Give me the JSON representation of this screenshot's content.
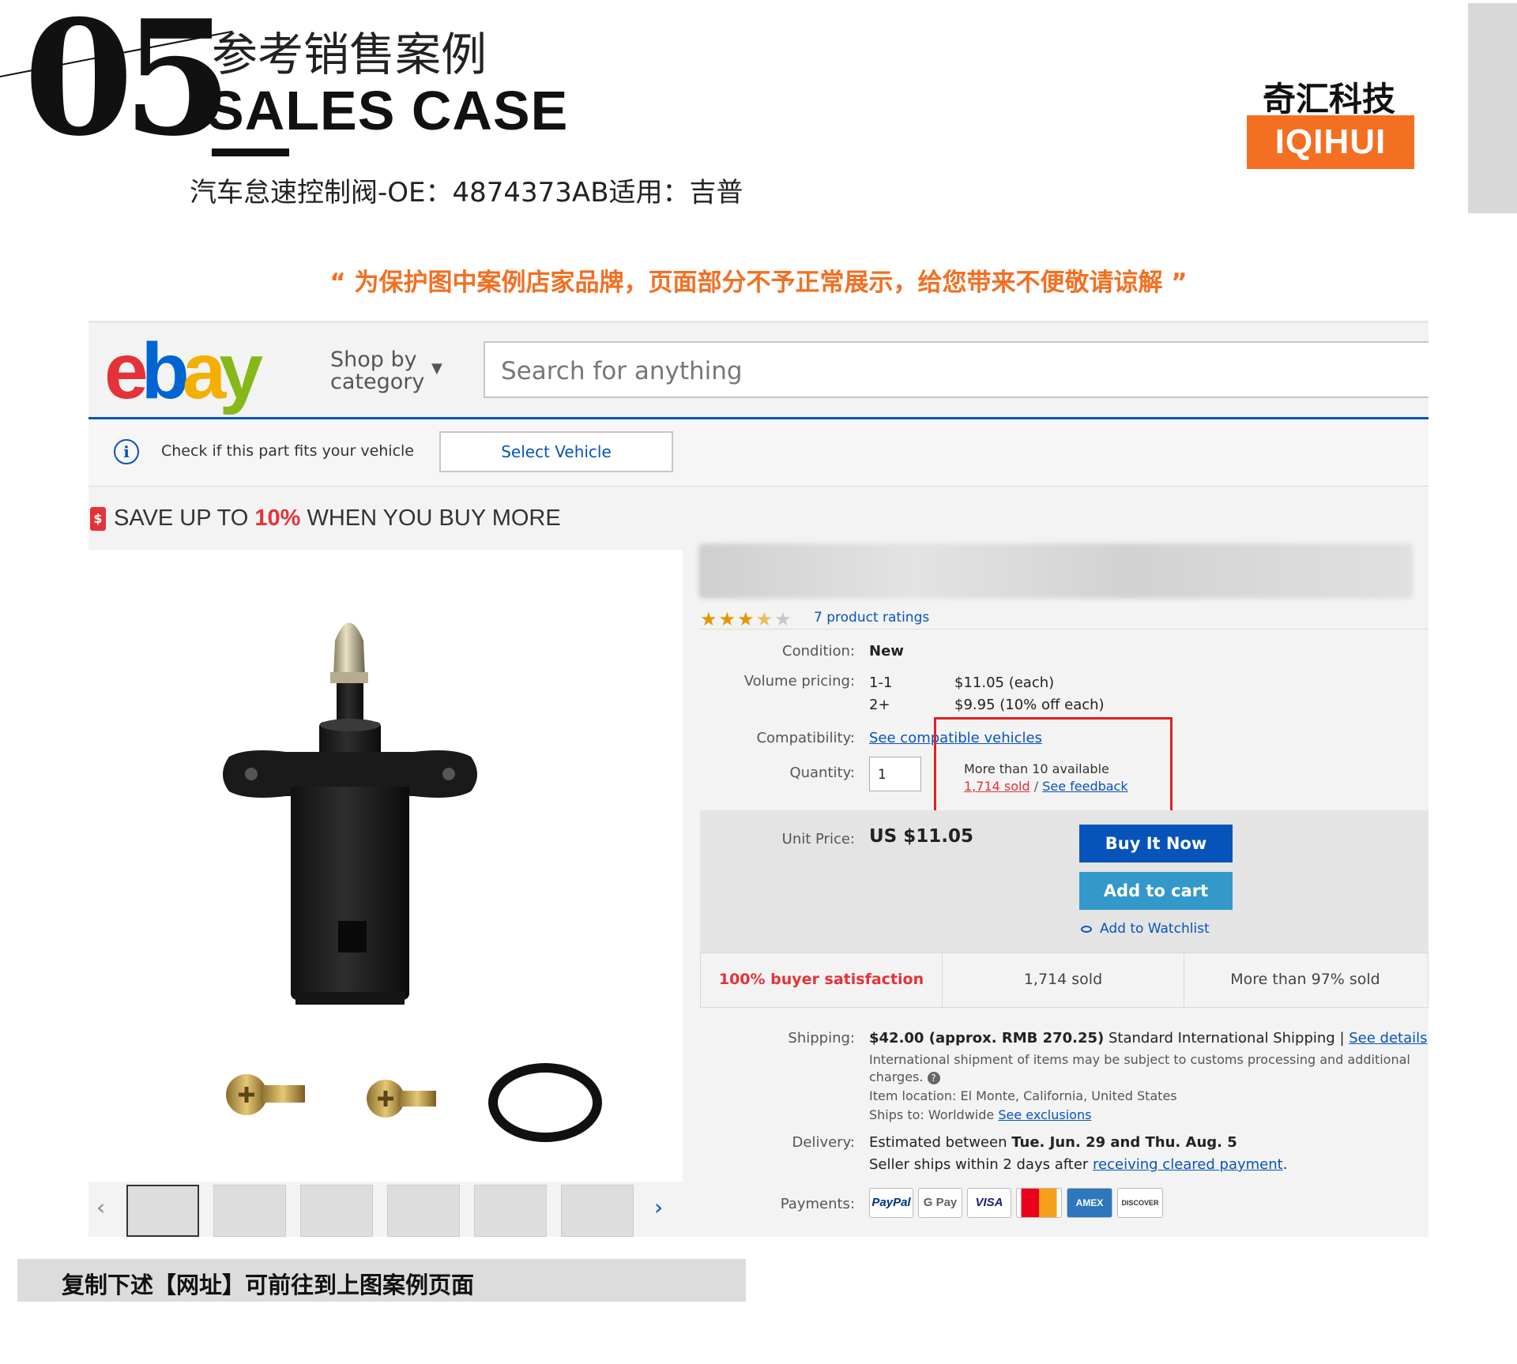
{
  "header": {
    "number": "05",
    "title_cn": "参考销售案例",
    "title_en": "SALES CASE",
    "subtitle": "汽车怠速控制阀-OE：4874373AB适用：吉普"
  },
  "brand": {
    "name_cn": "奇汇科技",
    "name_en": "IQIHUI",
    "accent": "#f36f22"
  },
  "notice": "“ 为保护图中案例店家品牌，页面部分不予正常展示，给您带来不便敬请谅解 ”",
  "ebay": {
    "logo": {
      "e": "e",
      "b": "b",
      "a": "a",
      "y": "y"
    },
    "shop_by_line1": "Shop by",
    "shop_by_line2": "category",
    "search_placeholder": "Search for anything",
    "fit_check_text": "Check if this part fits your vehicle",
    "select_vehicle": "Select Vehicle",
    "save_prefix": "SAVE UP TO ",
    "save_pct": "10%",
    "save_suffix": " WHEN YOU BUY MORE",
    "ratings_text": "7 product ratings",
    "rating_stars": 3.5,
    "condition_label": "Condition:",
    "condition_value": "New",
    "volume_label": "Volume pricing:",
    "volume_rows": [
      {
        "qty": "1-1",
        "price": "$11.05  (each)"
      },
      {
        "qty": "2+",
        "price": "$9.95  (10% off each)"
      }
    ],
    "compat_label": "Compatibility:",
    "compat_link": "See compatible vehicles",
    "quantity_label": "Quantity:",
    "quantity_value": "1",
    "availability": "More than 10 available",
    "sold_link": "1,714 sold",
    "slash": " / ",
    "feedback_link": "See feedback",
    "unit_price_label": "Unit Price:",
    "unit_price": "US $11.05",
    "buy_now": "Buy It Now",
    "add_to_cart": "Add to cart",
    "add_watchlist": "Add to Watchlist",
    "stats": [
      "100% buyer satisfaction",
      "1,714 sold",
      "More than 97% sold"
    ],
    "shipping_label": "Shipping:",
    "shipping_price": "$42.00 (approx. RMB 270.25)",
    "shipping_method": " Standard International Shipping | ",
    "shipping_details": "See details",
    "shipping_note1": "International shipment of items may be subject to customs processing and additional",
    "shipping_note2": "charges.",
    "item_location": "Item location:  El Monte, California, United States",
    "ships_to_prefix": "Ships to:  Worldwide  ",
    "ships_to_link": "See exclusions",
    "delivery_label": "Delivery:",
    "delivery_prefix": "Estimated between ",
    "delivery_dates": "Tue. Jun. 29 and Thu. Aug. 5",
    "delivery_note_prefix": "Seller ships within 2 days after ",
    "delivery_note_link": "receiving cleared payment",
    "delivery_note_suffix": ".",
    "payments_label": "Payments:",
    "payments": [
      "PayPal",
      "G Pay",
      "VISA",
      "MC",
      "AMEX",
      "DISCOVER"
    ]
  },
  "footer": {
    "text": "复制下述【网址】可前往到上图案例页面"
  }
}
